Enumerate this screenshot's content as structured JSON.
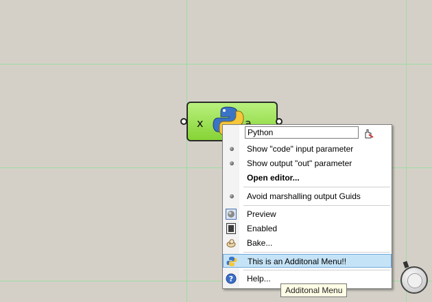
{
  "component": {
    "input_label": "x",
    "output_label": "a"
  },
  "context_menu": {
    "name_field_value": "Python",
    "items": [
      {
        "label": "Show \"code\" input parameter",
        "marker": "bullet"
      },
      {
        "label": "Show output \"out\" parameter",
        "marker": "bullet"
      },
      {
        "label": "Open editor...",
        "marker": "none",
        "bold": true
      },
      {
        "label": "Avoid marshalling output Guids",
        "marker": "bullet"
      },
      {
        "label": "Preview",
        "icon": "preview-icon"
      },
      {
        "label": "Enabled",
        "icon": "enabled-icon"
      },
      {
        "label": "Bake...",
        "icon": "bake-icon"
      },
      {
        "label": "This is an Additonal Menu!!",
        "icon": "python-icon",
        "highlighted": true
      },
      {
        "label": "Help...",
        "icon": "help-icon"
      }
    ]
  },
  "tooltip": {
    "text": "Additonal Menu"
  },
  "colors": {
    "canvas": "#d4d0c8",
    "gridline": "#9fdca0",
    "component_fill": "#a6e35d",
    "menu_highlight": "#c5e3f7"
  }
}
